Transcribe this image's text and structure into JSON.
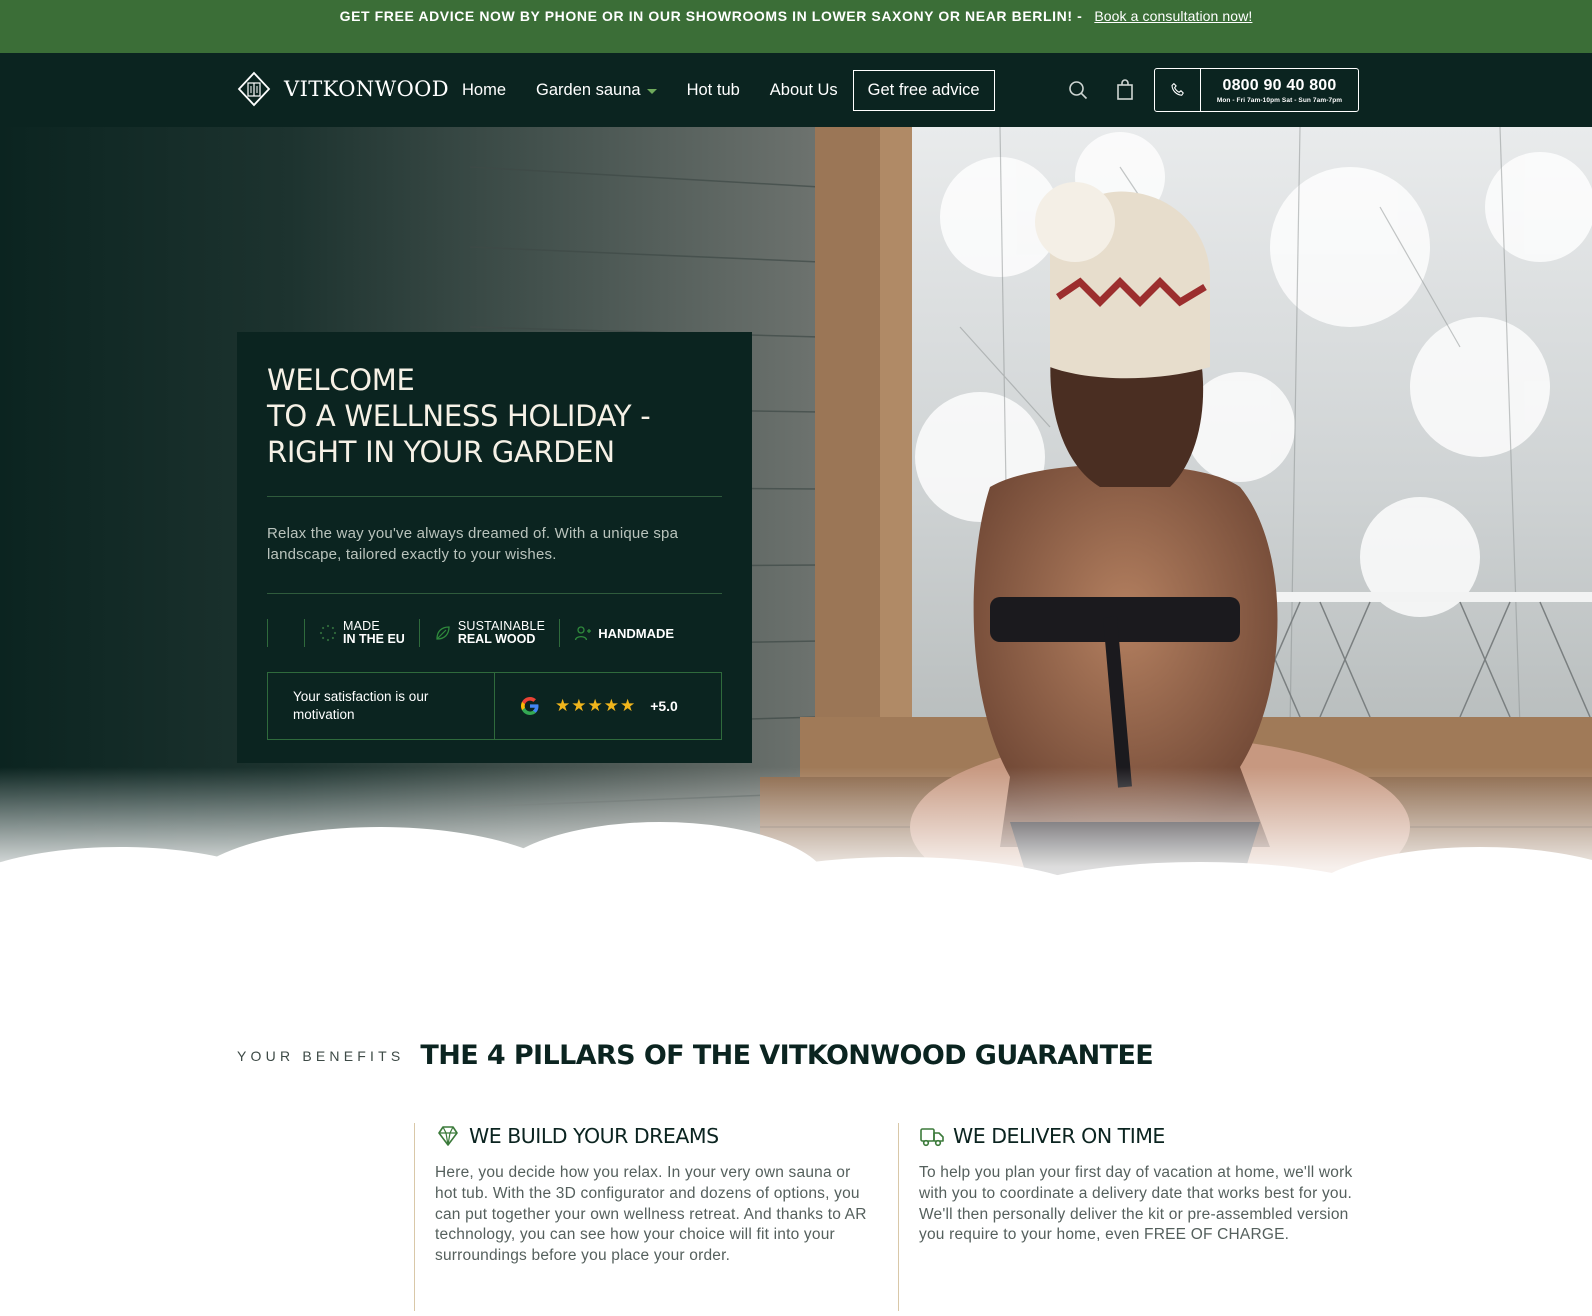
{
  "announcement": {
    "text": "GET FREE ADVICE NOW BY PHONE OR IN OUR SHOWROOMS IN LOWER SAXONY OR NEAR BERLIN! -",
    "link": "Book a consultation now!"
  },
  "header": {
    "brand": "VITKONWOOD",
    "nav": [
      "Home",
      "Garden sauna",
      "Hot tub",
      "About Us"
    ],
    "cta": "Get free advice",
    "phone": {
      "number": "0800 90 40 800",
      "hours": "Mon - Fri 7am-10pm Sat - Sun 7am-7pm"
    }
  },
  "hero": {
    "title": "WELCOME\nTO A WELLNESS HOLIDAY -\nRIGHT IN YOUR GARDEN",
    "subtitle": "Relax the way you've always dreamed of. With a unique spa landscape, tailored exactly to your wishes.",
    "badges": [
      {
        "line1": "MADE",
        "line2": "IN THE EU",
        "icon": "eu-stars-icon"
      },
      {
        "line1": "SUSTAINABLE",
        "line2": "REAL WOOD",
        "icon": "leaf-icon"
      },
      {
        "line1": "",
        "line2": "HANDMADE",
        "icon": "person-icon"
      }
    ],
    "rating": {
      "label": "Your satisfaction is our motivation",
      "stars": "★★★★★",
      "score": "+5.0",
      "provider_icon": "google-icon"
    }
  },
  "benefits": {
    "eyebrow": "YOUR BENEFITS",
    "title": "THE 4 PILLARS OF THE VITKONWOOD GUARANTEE",
    "pillars": [
      {
        "title": "WE BUILD YOUR DREAMS",
        "icon": "diamond-icon",
        "text": "Here, you decide how you relax. In your very own sauna or hot tub. With the 3D configurator and dozens of options, you can put together your own wellness retreat. And thanks to AR technology, you can see how your choice will fit into your surroundings before you place your order."
      },
      {
        "title": "WE DELIVER ON TIME",
        "icon": "truck-icon",
        "text": "To help you plan your first day of vacation at home, we'll work with you to coordinate a delivery date that works best for you. We'll then personally deliver the kit or pre-assembled version you require to your home, even FREE OF CHARGE."
      }
    ]
  },
  "colors": {
    "announcement_bg": "#3b6e37",
    "header_bg": "#0b2420",
    "accent_green": "#6faa5c",
    "star_gold": "#f0b51c"
  }
}
